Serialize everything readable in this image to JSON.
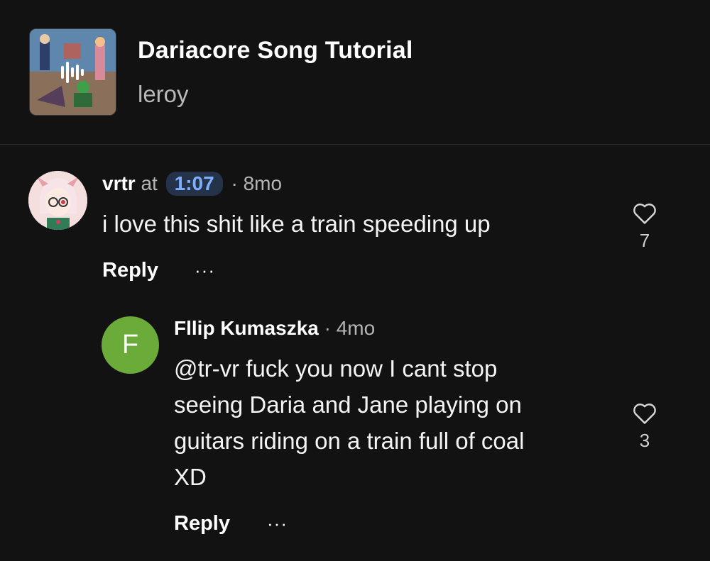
{
  "track": {
    "title": "Dariacore Song Tutorial",
    "artist": "leroy"
  },
  "comments": [
    {
      "username": "vrtr",
      "at_label": "at",
      "timestamp": "1:07",
      "separator": "·",
      "age": "8mo",
      "text": "i love this shit like a train speeding up",
      "likes": "7",
      "reply_label": "Reply",
      "more_label": "···",
      "avatar_style": "pink-haired character"
    },
    {
      "username": "Fllip Kumaszka",
      "separator": "·",
      "age": "4mo",
      "avatar_initial": "F",
      "avatar_color": "#6aab3a",
      "text_lines": [
        "@tr-vr fuck you now I cant stop",
        "seeing Daria and Jane playing on",
        "guitars riding on a train full of coal",
        "XD"
      ],
      "likes": "3",
      "reply_label": "Reply",
      "more_label": "···"
    }
  ],
  "colors": {
    "background": "#121212",
    "timestamp_bg": "#24324a",
    "timestamp_text": "#7fb0ff"
  }
}
